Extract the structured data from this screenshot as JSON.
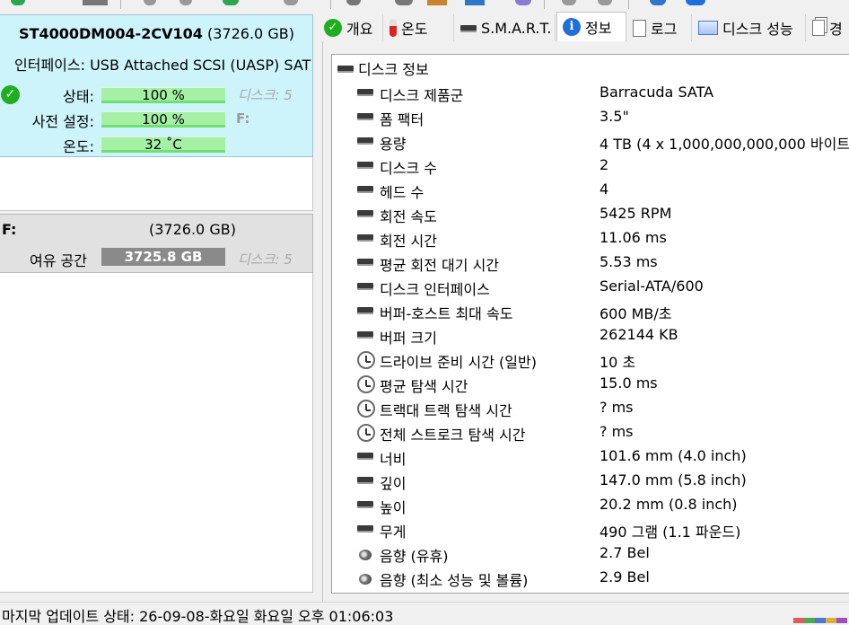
{
  "disk": {
    "title_model": "ST4000DM004-2CV104",
    "title_size": " (3726.0 GB)",
    "interface_label": "인터페이스:",
    "interface_value": " USB Attached SCSI (UASP) SAT",
    "status_label": "상태:",
    "status_value": "100 %",
    "disk_label_1": "디스크: 5",
    "preset_label": "사전 설정:",
    "preset_value": "100 %",
    "drive_letter_1": "F:",
    "temp_label": "온도:",
    "temp_value": "32 ˚C"
  },
  "volume": {
    "letter": "F:",
    "size": "(3726.0 GB)",
    "free_label": "여유 공간",
    "free_value": "3725.8 GB",
    "disk_label": "디스크: 5"
  },
  "tabs": [
    {
      "label": "개요",
      "icon": "check-circle-icon"
    },
    {
      "label": "온도",
      "icon": "thermometer-icon"
    },
    {
      "label": "S.M.A.R.T.",
      "icon": "disk-icon"
    },
    {
      "label": "정보",
      "icon": "info-icon"
    },
    {
      "label": "로그",
      "icon": "document-icon"
    },
    {
      "label": "디스크 성능",
      "icon": "chart-icon"
    },
    {
      "label": "경",
      "icon": "copy-icon"
    }
  ],
  "info": {
    "group_title": "디스크 정보",
    "rows": [
      {
        "label": "디스크 제품군",
        "value": "Barracuda SATA",
        "icon": "disk"
      },
      {
        "label": "폼 팩터",
        "value": "3.5\"",
        "icon": "disk"
      },
      {
        "label": "용량",
        "value": "4 TB (4 x 1,000,000,000,000 바이트)",
        "icon": "disk"
      },
      {
        "label": "디스크 수",
        "value": "2",
        "icon": "disk"
      },
      {
        "label": "헤드 수",
        "value": "4",
        "icon": "disk"
      },
      {
        "label": "회전 속도",
        "value": "5425 RPM",
        "icon": "disk"
      },
      {
        "label": "회전 시간",
        "value": "11.06 ms",
        "icon": "disk"
      },
      {
        "label": "평균 회전 대기 시간",
        "value": "5.53 ms",
        "icon": "disk"
      },
      {
        "label": "디스크 인터페이스",
        "value": "Serial-ATA/600",
        "icon": "disk"
      },
      {
        "label": "버퍼-호스트 최대 속도",
        "value": "600 MB/초",
        "icon": "disk"
      },
      {
        "label": "버퍼 크기",
        "value": "262144 KB",
        "icon": "disk"
      },
      {
        "label": "드라이브 준비 시간 (일반)",
        "value": "10 초",
        "icon": "clock"
      },
      {
        "label": "평균 탐색 시간",
        "value": "15.0 ms",
        "icon": "clock"
      },
      {
        "label": "트랙대 트랙 탐색 시간",
        "value": "? ms",
        "icon": "clock"
      },
      {
        "label": "전체 스트로크 탐색 시간",
        "value": "? ms",
        "icon": "clock"
      },
      {
        "label": "너비",
        "value": "101.6 mm (4.0 inch)",
        "icon": "disk"
      },
      {
        "label": "깊이",
        "value": "147.0 mm (5.8 inch)",
        "icon": "disk"
      },
      {
        "label": "높이",
        "value": "20.2 mm (0.8 inch)",
        "icon": "disk"
      },
      {
        "label": "무게",
        "value": "490 그램 (1.1 파운드)",
        "icon": "disk"
      },
      {
        "label": "음향 (유휴)",
        "value": "2.7 Bel",
        "icon": "speaker"
      },
      {
        "label": "음향 (최소 성능 및 볼륨)",
        "value": "2.9 Bel",
        "icon": "speaker"
      }
    ]
  },
  "statusbar": {
    "text": "마지막 업데이트 상태: 26-09-08-화요일 화요일 오후 01:06:03"
  },
  "colors": {
    "selected_card": "#cdf3fb",
    "health_bar": "#a6f0a6",
    "free_bar": "#8a8a8a",
    "ok_green": "#1fae1f",
    "info_blue": "#1e6fd9"
  }
}
